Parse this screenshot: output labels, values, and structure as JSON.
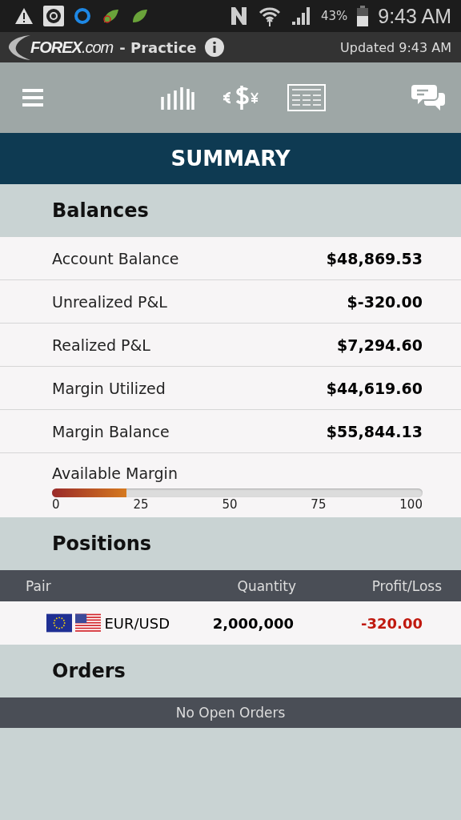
{
  "status_bar": {
    "battery": "43%",
    "time": "9:43 AM"
  },
  "header": {
    "logo": "**FOREX**.com",
    "mode": "- Practice",
    "updated": "Updated 9:43 AM"
  },
  "title": "SUMMARY",
  "balances": {
    "heading": "Balances",
    "rows": [
      {
        "label": "Account Balance",
        "value": "$48,869.53"
      },
      {
        "label": "Unrealized P&L",
        "value": "$-320.00"
      },
      {
        "label": "Realized P&L",
        "value": "$7,294.60"
      },
      {
        "label": "Margin Utilized",
        "value": "$44,619.60"
      },
      {
        "label": "Margin Balance",
        "value": "$55,844.13"
      }
    ],
    "available_margin": {
      "label": "Available Margin",
      "level": 0.2,
      "ticks": [
        "0",
        "25",
        "50",
        "75",
        "100"
      ]
    }
  },
  "positions": {
    "heading": "Positions",
    "columns": [
      "Pair",
      "Quantity",
      "Profit/Loss"
    ],
    "rows": [
      {
        "pair": "EUR/USD",
        "quantity": "2,000,000",
        "profit_loss": "-320.00"
      }
    ]
  },
  "orders": {
    "heading": "Orders",
    "message": "No Open Orders"
  }
}
